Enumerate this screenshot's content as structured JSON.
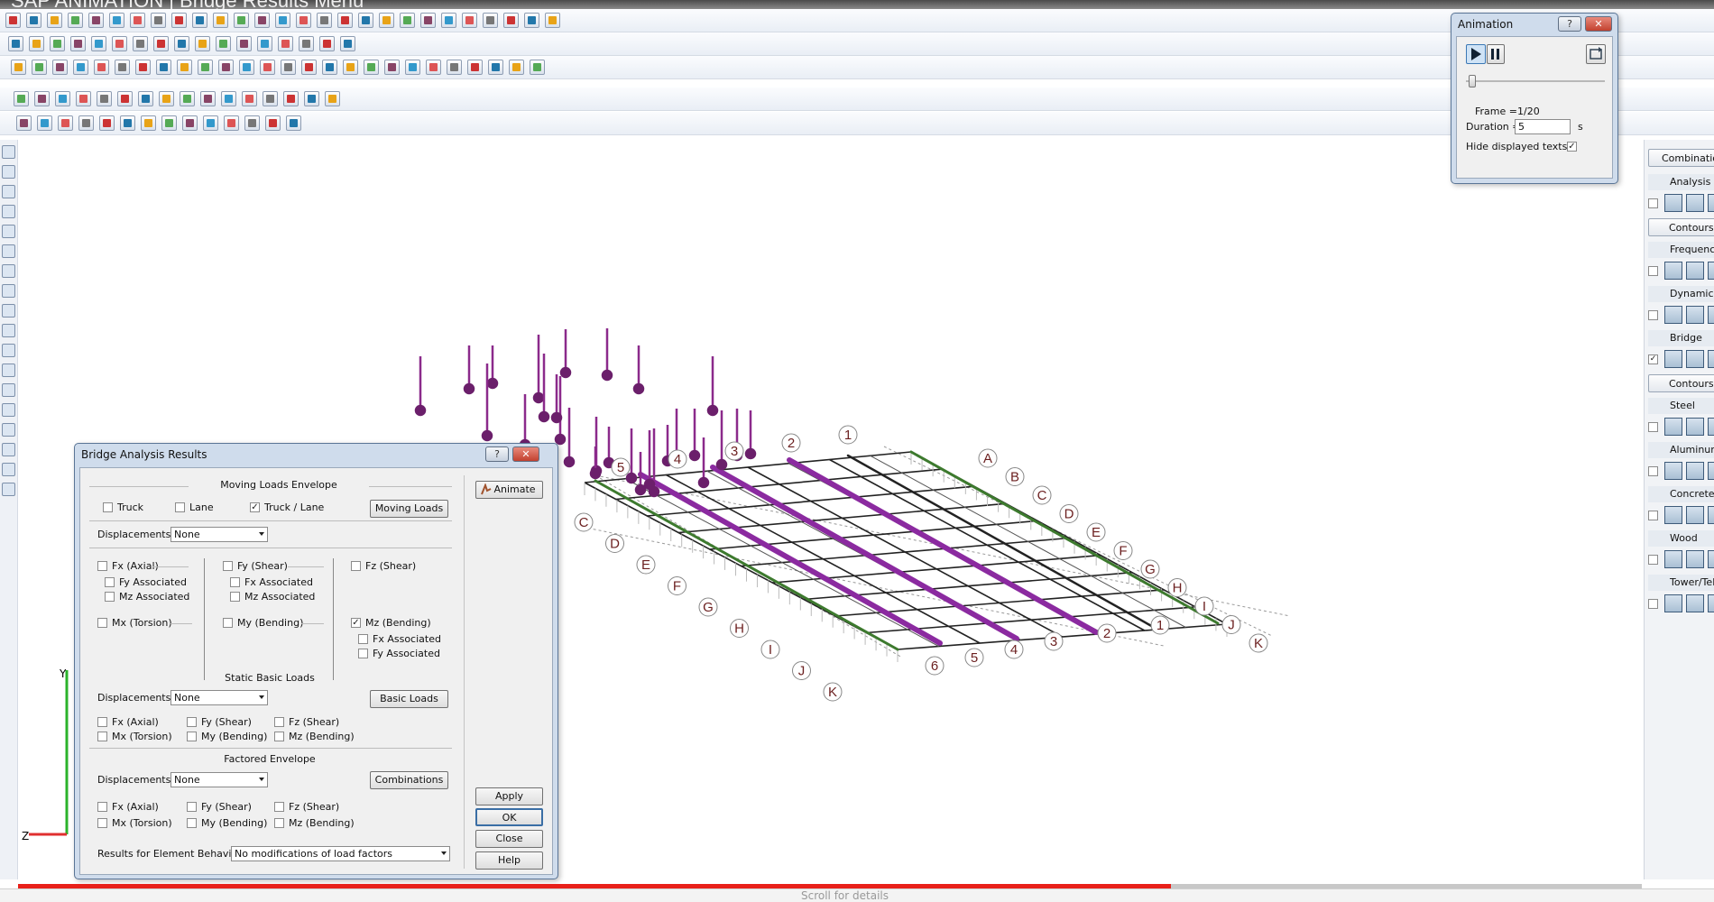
{
  "app": {
    "title": "SAP ANIMATION | Bridge Results Menu"
  },
  "toolbar_icons": {
    "row1": [
      "new-file-icon",
      "open-icon",
      "save-icon",
      "print-icon",
      "undo-icon",
      "redo-icon",
      "copy-icon",
      "cut-icon",
      "paste-icon",
      "view-icon",
      "frame-icon",
      "node-icon",
      "member-icon",
      "plate-icon",
      "solid-icon",
      "load-icon",
      "support-icon",
      "spring-icon",
      "release-icon",
      "section-icon",
      "material-icon",
      "ruler-icon",
      "scale-icon",
      "filter-icon",
      "color-icon",
      "render-icon",
      "help-icon"
    ],
    "row2": [
      "select-icon",
      "select-all-icon",
      "deselect-icon",
      "invert-icon",
      "window-icon",
      "cascade-icon",
      "tile-icon",
      "zoom-icon",
      "zoom-window-icon",
      "zoom-extents-icon",
      "zoom-previous-icon",
      "pan-icon",
      "rotate-icon",
      "fit-icon",
      "refresh-icon",
      "grid-icon",
      "snap-icon"
    ],
    "row3": [
      "add-node-icon",
      "add-member-icon",
      "add-plate-icon",
      "delete-icon",
      "move-icon",
      "copy-icon",
      "mirror-icon",
      "rotate-member-icon",
      "split-icon",
      "merge-icon",
      "extrude-icon",
      "array-icon",
      "offset-icon",
      "trim-icon",
      "extend-icon",
      "fillet-icon",
      "chamfer-icon",
      "check-icon",
      "measure-icon",
      "color-wheel-icon",
      "legend-icon",
      "table-icon",
      "report-icon",
      "export-icon",
      "import-icon",
      "settings-icon"
    ],
    "row4": [
      "results-icon",
      "deformed-icon",
      "axial-icon",
      "shear-icon",
      "moment-icon",
      "torsion-icon",
      "reaction-icon",
      "stress-icon",
      "design-icon",
      "steel-icon",
      "concrete-icon",
      "wood-icon",
      "aluminum-icon",
      "connection-icon",
      "footing-icon",
      "report-icon"
    ],
    "row5": [
      "axis-icon",
      "node-axis-icon",
      "grid-line-icon",
      "beam-icon",
      "column-icon",
      "brace-icon",
      "truss-icon",
      "load-line-icon",
      "panel-icon",
      "floor-icon",
      "story-icon",
      "level-icon",
      "section-cut-icon",
      "table-icon"
    ]
  },
  "left_toolbar": [
    "hand-icon",
    "globe-icon",
    "layers-icon",
    "orbit-icon",
    "zoom-in-icon",
    "zoom-out-icon",
    "view-front-icon",
    "view-back-icon",
    "view-top-icon",
    "view-bottom-icon",
    "view-left-icon",
    "view-right-icon",
    "view-iso-icon",
    "grid-icon",
    "shade-icon",
    "eye-icon",
    "layers-color-icon",
    "render-icon"
  ],
  "animation": {
    "title": "Animation",
    "help": "?",
    "close": "✕",
    "frame_label": "Frame =",
    "frame_value": "1/20",
    "duration_label": "Duration =",
    "duration_value": "5",
    "duration_unit": "s",
    "hide_texts_label": "Hide displayed texts",
    "hide_texts_checked": "✓",
    "slider_position": 0.02
  },
  "right_panel": {
    "top_button": "Combinations",
    "sections": [
      {
        "title": "Analysis",
        "checked": "",
        "contours": "Contours"
      },
      {
        "title": "Frequency/Buckling",
        "checked": ""
      },
      {
        "title": "Dynamic",
        "checked": ""
      },
      {
        "title": "Bridge",
        "checked": "✓",
        "contours": "Contours"
      },
      {
        "title": "Steel",
        "checked": ""
      },
      {
        "title": "Aluminum",
        "checked": ""
      },
      {
        "title": "Concrete",
        "checked": ""
      },
      {
        "title": "Wood",
        "checked": ""
      },
      {
        "title": "Tower/Telecom",
        "checked": ""
      }
    ]
  },
  "bridge_dialog": {
    "title": "Bridge Analysis Results",
    "help": "?",
    "close": "✕",
    "moving": {
      "header": "Moving Loads Envelope",
      "truck": "Truck",
      "truck_checked": "",
      "lane": "Lane",
      "lane_checked": "",
      "truck_lane": "Truck / Lane",
      "truck_lane_checked": "✓",
      "moving_loads_button": "Moving Loads",
      "displacements_label": "Displacements:",
      "displacements_value": "None",
      "fx_axial": "Fx (Axial)",
      "fy_shear": "Fy (Shear)",
      "fz_shear": "Fz (Shear)",
      "fy_associated": "Fy Associated",
      "mz_associated": "Mz Associated",
      "fx_associated": "Fx Associated",
      "mz_associated2": "Mz Associated",
      "mx_torsion": "Mx (Torsion)",
      "my_bending": "My (Bending)",
      "mz_bending": "Mz (Bending)",
      "mz_bending_checked": "✓",
      "mz_fx_associated": "Fx Associated",
      "mz_fy_associated": "Fy Associated"
    },
    "static": {
      "header": "Static Basic Loads",
      "displacements_label": "Displacements:",
      "displacements_value": "None",
      "basic_loads_button": "Basic Loads",
      "fx_axial": "Fx (Axial)",
      "fy_shear": "Fy (Shear)",
      "fz_shear": "Fz (Shear)",
      "mx_torsion": "Mx (Torsion)",
      "my_bending": "My (Bending)",
      "mz_bending": "Mz (Bending)"
    },
    "factored": {
      "header": "Factored Envelope",
      "displacements_label": "Displacements:",
      "displacements_value": "None",
      "combinations_button": "Combinations",
      "fx_axial": "Fx (Axial)",
      "fy_shear": "Fy (Shear)",
      "fz_shear": "Fz (Shear)",
      "mx_torsion": "Mx (Torsion)",
      "my_bending": "My (Bending)",
      "mz_bending": "Mz (Bending)"
    },
    "behavior_label": "Results for Element Behavior:",
    "behavior_value": "No modifications of load factors",
    "animate_button": "Animate",
    "apply_button": "Apply",
    "ok_button": "OK",
    "close_button": "Close",
    "help_button": "Help"
  },
  "model": {
    "letters_front": [
      "C",
      "D",
      "E",
      "F",
      "G",
      "H",
      "I",
      "J",
      "K"
    ],
    "letters_back": [
      "A",
      "B",
      "C",
      "D",
      "E",
      "F",
      "G",
      "H",
      "I",
      "J",
      "K"
    ],
    "numbers_left": [
      "5",
      "4",
      "3",
      "2",
      "1"
    ],
    "numbers_bottom": [
      "6",
      "5",
      "4",
      "3",
      "2",
      "1"
    ],
    "left_label": "5",
    "axis_y": "Y",
    "axis_z": "Z"
  },
  "video": {
    "progress": 0.71,
    "caption": "Scroll for details"
  }
}
